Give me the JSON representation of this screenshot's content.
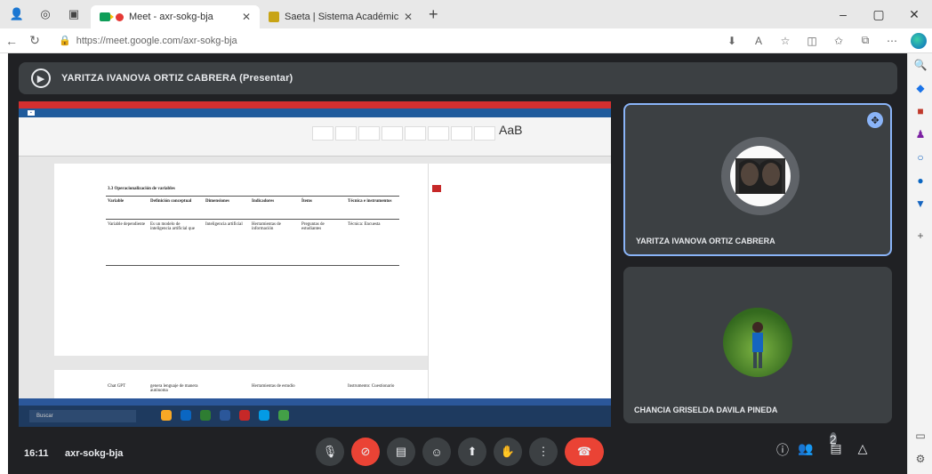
{
  "browser": {
    "tabs": [
      {
        "title": "Meet - axr-sokg-bja",
        "active": true
      },
      {
        "title": "Saeta | Sistema Académico Ins",
        "active": false
      }
    ],
    "url": "https://meet.google.com/axr-sokg-bja",
    "window_controls": [
      "–",
      "▢",
      "✕"
    ]
  },
  "meet": {
    "presenter_label": "YARITZA IVANOVA ORTIZ CABRERA (Presentar)",
    "participants": [
      {
        "name": "YARITZA IVANOVA ORTIZ CABRERA",
        "pinned": true
      },
      {
        "name": "CHANCIA GRISELDA DAVILA PINEDA",
        "pinned": false
      }
    ],
    "time": "16:11",
    "meeting_code": "axr-sokg-bja",
    "participant_count": "2"
  },
  "shared_doc": {
    "heading": "3.3 Operacionalización de variables",
    "columns": [
      "Variable",
      "Definición conceptual",
      "Dimensiones",
      "Indicadores",
      "Ítems",
      "Técnica e instrumentos"
    ],
    "row1": [
      "Variable dependiente",
      "Es un modelo de inteligencia artificial que",
      "Inteligencia artificial",
      "Herramientas de información",
      "Preguntas de estudiantes",
      "Técnica: Encuesta"
    ],
    "row2": [
      "Chat GPT",
      "genera lenguaje de manera autónoma",
      "",
      "Herramientas de estudio",
      "",
      "Instrumento: Cuestionario"
    ],
    "search_placeholder": "Buscar"
  },
  "colors": {
    "meet_bg": "#202124",
    "tile_bg": "#3c4043",
    "accent": "#8ab4f8",
    "hangup": "#ea4335",
    "word_blue": "#2b579a"
  }
}
